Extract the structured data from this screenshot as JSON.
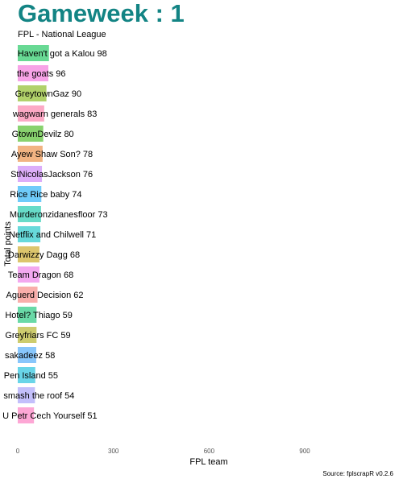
{
  "title": "Gameweek : 1",
  "subtitle": "FPL - National League",
  "caption": "Source: fplscrapR v0.2.6",
  "chart_data": {
    "type": "bar",
    "orientation": "horizontal",
    "xlabel": "FPL team",
    "ylabel": "Total points",
    "xlim": [
      0,
      1150
    ],
    "xticks": [
      "0",
      "300",
      "600",
      "900"
    ],
    "grid": false,
    "categories": [
      "Haven't got a Kalou",
      "the goats",
      "GreytownGaz",
      "wagwarn generals",
      "GtownDevilz",
      "Ayew Shaw Son?",
      "StNicolasJackson",
      "Rice Rice baby",
      "Murderonzidanesfloor",
      "Netflix and Chilwell",
      "Darwizzy Dagg",
      "Team Dragon",
      "Aguerd Decision",
      "Hotel? Thiago",
      "Greyfriars FC",
      "sakadeez",
      "Pen Island",
      "smash the roof",
      "U Petr Cech Yourself"
    ],
    "values": [
      98,
      96,
      90,
      83,
      80,
      78,
      76,
      74,
      73,
      71,
      68,
      68,
      62,
      59,
      59,
      58,
      55,
      54,
      51
    ],
    "bar_labels": [
      "Haven't got a Kalou 98",
      "the goats 96",
      "GreytownGaz 90",
      "wagwarn generals 83",
      "GtownDevilz 80",
      "Ayew Shaw Son? 78",
      "StNicolasJackson 76",
      "Rice Rice baby 74",
      "Murderonzidanesfloor 73",
      "Netflix and Chilwell 71",
      "Darwizzy Dagg 68",
      "Team Dragon 68",
      "Aguerd Decision 62",
      "Hotel? Thiago 59",
      "Greyfriars FC 59",
      "sakadeez 58",
      "Pen Island 55",
      "smash the roof 54",
      "U Petr Cech Yourself 51"
    ],
    "colors": [
      "#68d994",
      "#f7a3e7",
      "#b1d16a",
      "#fca9c5",
      "#88d26e",
      "#f1b382",
      "#dcadf9",
      "#6fcbfa",
      "#67dbc8",
      "#67d9da",
      "#dcc56c",
      "#f3a8ef",
      "#f9aeab",
      "#69d9a7",
      "#cdcc6e",
      "#88c6fb",
      "#69d5e8",
      "#c3bffb",
      "#fda7d5"
    ]
  }
}
